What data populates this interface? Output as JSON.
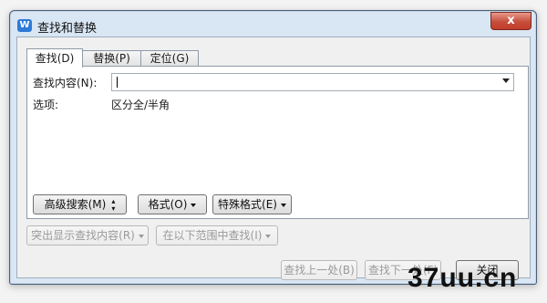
{
  "window": {
    "icon_letter": "W",
    "title": "查找和替换",
    "close_label": "x"
  },
  "tabs": [
    {
      "label": "查找(D)",
      "active": true
    },
    {
      "label": "替换(P)",
      "active": false
    },
    {
      "label": "定位(G)",
      "active": false
    }
  ],
  "find": {
    "label": "查找内容(N):",
    "value": "",
    "options_label": "选项:",
    "options_value": "区分全/半角"
  },
  "panel_buttons": {
    "advanced": "高级搜索(M)",
    "format": "格式(O)",
    "special": "特殊格式(E)"
  },
  "lower": {
    "highlight": "突出显示查找内容(R)",
    "within": "在以下范围中查找(I)"
  },
  "footer": {
    "find_prev": "查找上一处(B)",
    "find_next": "查找下一处(F)",
    "close": "关闭"
  },
  "watermark": "37uu.cn"
}
